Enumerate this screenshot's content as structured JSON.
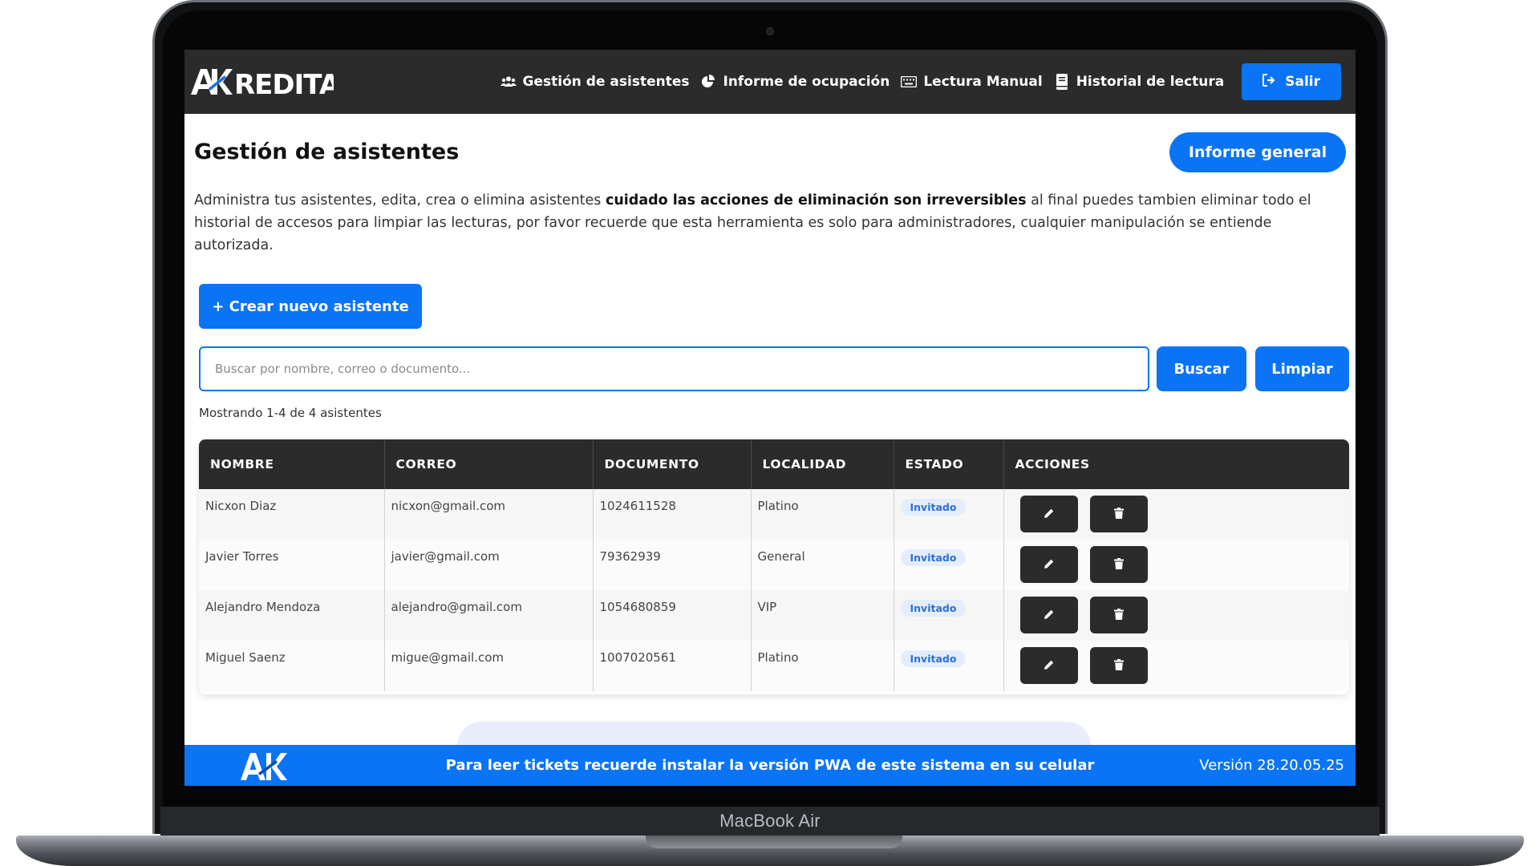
{
  "device": {
    "label": "MacBook Air"
  },
  "brand": {
    "logo_text": "AKREDITAR",
    "footer_logo_text": "AK"
  },
  "nav": {
    "items": [
      {
        "label": "Gestión de asistentes",
        "icon": "users-icon"
      },
      {
        "label": "Informe de ocupación",
        "icon": "chart-pie-icon"
      },
      {
        "label": "Lectura Manual",
        "icon": "keyboard-icon"
      },
      {
        "label": "Historial de lectura",
        "icon": "book-icon"
      }
    ],
    "logout_label": "Salir",
    "logout_icon": "sign-out-icon"
  },
  "page": {
    "title": "Gestión de asistentes",
    "report_button": "Informe general",
    "description_part1": "Administra tus asistentes, edita, crea o elimina asistentes ",
    "description_bold": "cuidado las acciones de eliminación son irreversibles",
    "description_part2": " al final puedes tambien eliminar todo el historial de accesos para limpiar las lecturas, por favor recuerde que esta herramienta es solo para administradores, cualquier manipulación se entiende autorizada.",
    "create_button": "+ Crear nuevo asistente"
  },
  "search": {
    "placeholder": "Buscar por nombre, correo o documento...",
    "value": "",
    "search_button": "Buscar",
    "clear_button": "Limpiar",
    "results_text": "Mostrando 1-4 de 4 asistentes"
  },
  "table": {
    "headers": [
      "NOMBRE",
      "CORREO",
      "DOCUMENTO",
      "LOCALIDAD",
      "ESTADO",
      "ACCIONES"
    ],
    "rows": [
      {
        "nombre": "Nicxon Diaz",
        "correo": "nicxon@gmail.com",
        "documento": "1024611528",
        "localidad": "Platino",
        "estado": "Invitado"
      },
      {
        "nombre": "Javier Torres",
        "correo": "javier@gmail.com",
        "documento": "79362939",
        "localidad": "General",
        "estado": "Invitado"
      },
      {
        "nombre": "Alejandro Mendoza",
        "correo": "alejandro@gmail.com",
        "documento": "1054680859",
        "localidad": "VIP",
        "estado": "Invitado"
      },
      {
        "nombre": "Miguel Saenz",
        "correo": "migue@gmail.com",
        "documento": "1007020561",
        "localidad": "Platino",
        "estado": "Invitado"
      }
    ],
    "edit_icon": "pencil-icon",
    "delete_icon": "trash-icon"
  },
  "footer": {
    "message": "Para leer tickets recuerde instalar la versión PWA de este sistema en su celular",
    "version": "Versión 28.20.05.25"
  },
  "colors": {
    "primary": "#0a74f5",
    "navbar": "#2b2b2b",
    "badge_bg": "#e3edfb",
    "badge_text": "#2d6fd6"
  }
}
